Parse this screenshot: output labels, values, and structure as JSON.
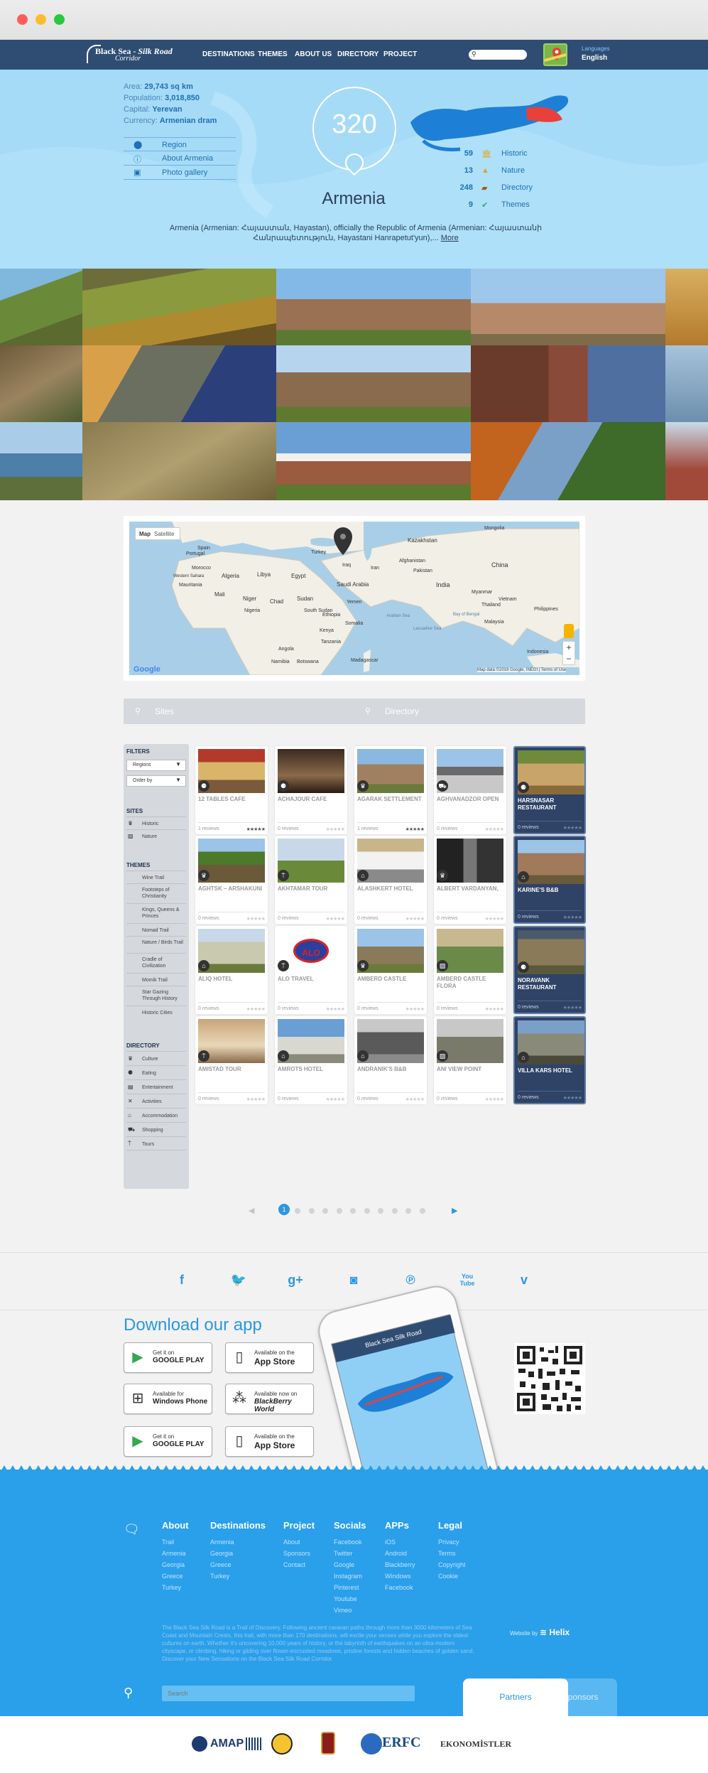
{
  "nav": {
    "logo_line1": "Black Sea",
    "logo_line1b": "Silk Road",
    "logo_line2": "Corridor",
    "links": [
      "DESTINATIONS",
      "THEMES",
      "ABOUT US",
      "DIRECTORY",
      "PROJECT"
    ],
    "languages_label": "Languages",
    "language_value": "English"
  },
  "hero": {
    "area_label": "Area:",
    "area_value": "29,743 sq km",
    "population_label": "Population:",
    "population_value": "3,018,850",
    "capital_label": "Capital:",
    "capital_value": "Yerevan",
    "currency_label": "Currency:",
    "currency_value": "Armenian dram",
    "links": [
      "Region",
      "About Armenia",
      "Photo gallery"
    ],
    "count": "320",
    "country": "Armenia",
    "description": "Armenia (Armenian: Հայաստան, Hayastan), officially the Republic of Armenia (Armenian: Հայաստանի Հանրապետություն, Hayastani Hanrapetut'yun),...",
    "more": "More",
    "stats": [
      {
        "num": "59",
        "label": "Historic"
      },
      {
        "num": "13",
        "label": "Nature"
      },
      {
        "num": "248",
        "label": "Directory"
      },
      {
        "num": "9",
        "label": "Themes"
      }
    ]
  },
  "map": {
    "btn_map": "Map",
    "btn_satellite": "Satellite",
    "labels": [
      "Portugal",
      "Spain",
      "Morocco",
      "Algeria",
      "Libya",
      "Egypt",
      "Mali",
      "Niger",
      "Chad",
      "Sudan",
      "Nigeria",
      "Ethiopia",
      "Kenya",
      "Angola",
      "Namibia",
      "Botswana",
      "South Sudan",
      "Somalia",
      "Saudi Arabia",
      "Yemen",
      "Iraq",
      "Iran",
      "Turkey",
      "Kazakhstan",
      "Afghanistan",
      "Pakistan",
      "India",
      "China",
      "Mongolia",
      "Myanmar",
      "Thailand",
      "Vietnam",
      "Malaysia",
      "Philippines",
      "Indonesia",
      "Mauritania",
      "Western Sahara",
      "Tanzania",
      "Madagascar",
      "Bay of Bengal",
      "Arabian Sea",
      "Laccadive Sea"
    ],
    "zoom_in": "+",
    "zoom_out": "−",
    "google": "Google",
    "attribution": "Map data ©2016 Google, INEGI | Terms of Use"
  },
  "search": {
    "sites": "Sites",
    "directory": "Directory"
  },
  "filters": {
    "title": "FILTERS",
    "regions": "Regions",
    "order": "Order by",
    "sites_title": "SITES",
    "sites": [
      "Historic",
      "Nature"
    ],
    "themes_title": "THEMES",
    "themes": [
      "Wine Trail",
      "Footsteps of Christianity",
      "Kings, Queens & Princes",
      "Nomad Trail",
      "Nature / Birds Trail",
      "Cradle of Civilization",
      "Momik Trail",
      "Star Gazing Through History",
      "Historic Cities"
    ],
    "directory_title": "DIRECTORY",
    "directory": [
      "Culture",
      "Eating",
      "Entertainment",
      "Activities",
      "Accommodation",
      "Shopping",
      "Tours"
    ]
  },
  "cards": [
    {
      "title": "12 TABLES CAFE",
      "reviews": "1 reviews",
      "icon": "fork-icon",
      "dark": false
    },
    {
      "title": "ACHAJOUR CAFE",
      "reviews": "0 reviews",
      "icon": "fork-icon",
      "dark": false
    },
    {
      "title": "AGARAK SETTLEMENT",
      "reviews": "1 reviews",
      "icon": "crown-icon",
      "dark": false
    },
    {
      "title": "AGHVANADZOR OPEN",
      "reviews": "0 reviews",
      "icon": "cart-icon",
      "dark": false
    },
    {
      "title": "HARSNASAR RESTAURANT",
      "reviews": "0 reviews",
      "icon": "fork-icon",
      "dark": true
    },
    {
      "title": "AGHTSK – ARSHAKUNI",
      "reviews": "0 reviews",
      "icon": "crown-icon",
      "dark": false
    },
    {
      "title": "AKHTAMAR TOUR",
      "reviews": "0 reviews",
      "icon": "signpost-icon",
      "dark": false
    },
    {
      "title": "ALASHKERT HOTEL",
      "reviews": "0 reviews",
      "icon": "home-icon",
      "dark": false
    },
    {
      "title": "ALBERT VARDANYAN,",
      "reviews": "0 reviews",
      "icon": "crown-icon",
      "dark": false
    },
    {
      "title": "KARINE'S B&B",
      "reviews": "0 reviews",
      "icon": "home-icon",
      "dark": true
    },
    {
      "title": "ALIQ HOTEL",
      "reviews": "0 reviews",
      "icon": "home-icon",
      "dark": false
    },
    {
      "title": "ALO TRAVEL",
      "reviews": "0 reviews",
      "icon": "signpost-icon",
      "dark": false
    },
    {
      "title": "AMBERD CASTLE",
      "reviews": "0 reviews",
      "icon": "crown-icon",
      "dark": false
    },
    {
      "title": "AMBERD CASTLE FLORA",
      "reviews": "0 reviews",
      "icon": "image-icon",
      "dark": false
    },
    {
      "title": "NORAVANK RESTAURANT",
      "reviews": "0 reviews",
      "icon": "fork-icon",
      "dark": true
    },
    {
      "title": "AMISTAD TOUR",
      "reviews": "0 reviews",
      "icon": "signpost-icon",
      "dark": false
    },
    {
      "title": "AMROTS HOTEL",
      "reviews": "0 reviews",
      "icon": "home-icon",
      "dark": false
    },
    {
      "title": "ANDRANIK'S B&B",
      "reviews": "0 reviews",
      "icon": "home-icon",
      "dark": false
    },
    {
      "title": "ANI VIEW POINT",
      "reviews": "0 reviews",
      "icon": "image-icon",
      "dark": false
    },
    {
      "title": "VILLA KARS HOTEL",
      "reviews": "0 reviews",
      "icon": "home-icon",
      "dark": true
    }
  ],
  "alo_text": "ALO",
  "pagination": {
    "current": "1",
    "prev": "◀",
    "next": "▶"
  },
  "social": [
    "f",
    "t",
    "g+",
    "ig",
    "p",
    "You Tube",
    "v"
  ],
  "app": {
    "title": "Download our app",
    "stores": [
      {
        "small": "Get it on",
        "big": "GOOGLE PLAY"
      },
      {
        "small": "Available on the",
        "big": "App Store"
      },
      {
        "small": "Available for",
        "big": "Windows Phone"
      },
      {
        "small": "Available now on",
        "big": "BlackBerry World"
      },
      {
        "small": "Get it on",
        "big": "GOOGLE PLAY"
      },
      {
        "small": "Available on the",
        "big": "App Store"
      }
    ],
    "phone_title": "Black Sea Silk Road"
  },
  "footer": {
    "cols": [
      {
        "title": "About",
        "links": [
          "Trail",
          "Armenia",
          "Georgia",
          "Greece",
          "Turkey"
        ]
      },
      {
        "title": "Destinations",
        "links": [
          "Armenia",
          "Georgia",
          "Greece",
          "Turkey"
        ]
      },
      {
        "title": "Project",
        "links": [
          "About",
          "Sponsors",
          "Contact"
        ]
      },
      {
        "title": "Socials",
        "links": [
          "Facebook",
          "Twitter",
          "Google",
          "Instagram",
          "Pinterest",
          "Youtube",
          "Vimeo"
        ]
      },
      {
        "title": "APPs",
        "links": [
          "iOS",
          "Android",
          "Blackberry",
          "Windows",
          "Facebook"
        ]
      },
      {
        "title": "Legal",
        "links": [
          "Privacy",
          "Terms",
          "Copyright",
          "Cookie"
        ]
      }
    ],
    "about": "The Black Sea Silk Road is a Trail of Discovery. Following ancient caravan paths through more than 3000 kilometers of Sea Coast and Mountain Crests, this trail, with more than 170 destinations, will excite your senses while you explore the oldest cultures on earth. Whether it's uncovering 10,000 years of history, or the labyrinth of earthquakes on an ultra-modern cityscape, or climbing, hiking or gliding over flower-encrusted meadows, pristine forests and hidden beaches of golden sand, Discover your New Sensations on the Black Sea Silk Road Corridor.",
    "website_by": "Website by",
    "helix": "Helix",
    "search_placeholder": "Search",
    "tab_partners": "Partners",
    "tab_sponsors": "Sponsors"
  },
  "partners": {
    "amap": "AMAP",
    "erfc": "ERFC",
    "ekonomistler": "EKONOMİSTLER"
  },
  "colors": {
    "nav": "#2f4d73",
    "accent": "#2a97e0",
    "hero": "#a6dbf7",
    "footer": "#2a9fea",
    "dark_card": "#2e4366"
  }
}
